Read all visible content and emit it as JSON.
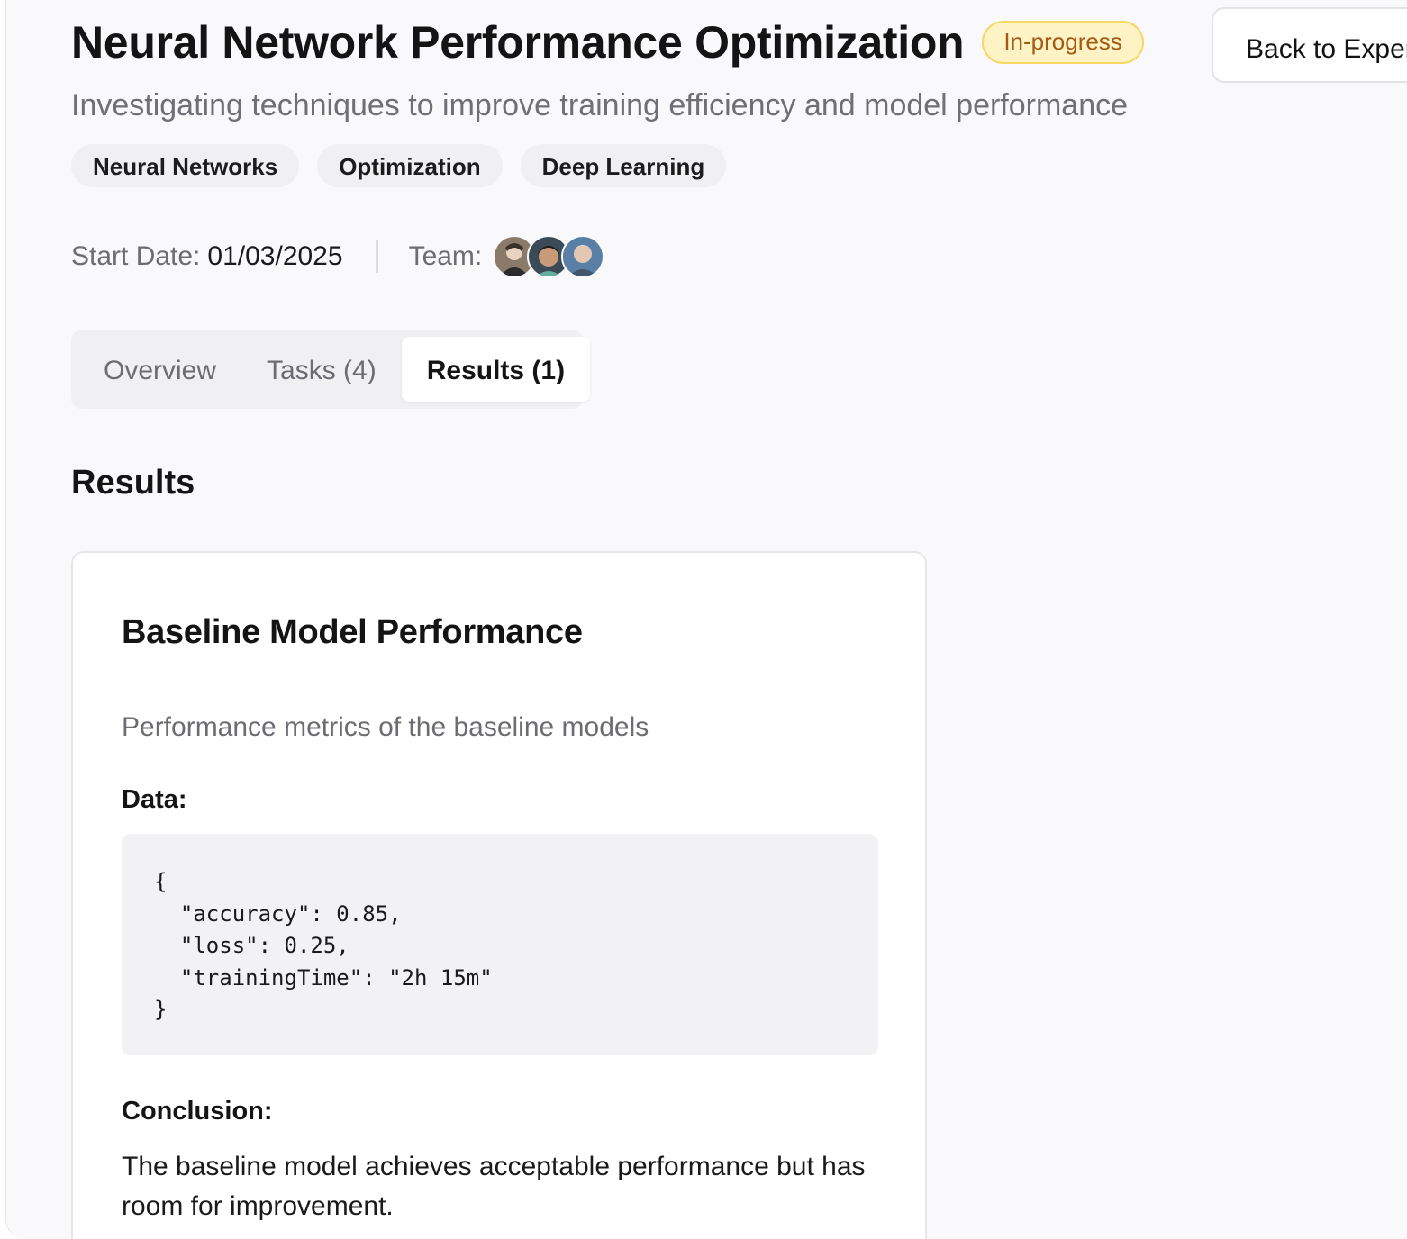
{
  "header": {
    "title": "Neural Network Performance Optimization",
    "status": "In-progress",
    "back_button_label": "Back to Experiments",
    "subtitle": "Investigating techniques to improve training efficiency and model performance"
  },
  "tags": [
    "Neural Networks",
    "Optimization",
    "Deep Learning"
  ],
  "meta": {
    "start_date_label": "Start Date:",
    "start_date": "01/03/2025",
    "team_label": "Team:",
    "team_count": 3
  },
  "tabs": [
    {
      "label": "Overview",
      "active": false
    },
    {
      "label": "Tasks (4)",
      "active": false
    },
    {
      "label": "Results (1)",
      "active": true
    }
  ],
  "results": {
    "heading": "Results",
    "items": [
      {
        "title": "Baseline Model Performance",
        "description": "Performance metrics of the baseline models",
        "data_label": "Data:",
        "data_code": "{\n  \"accuracy\": 0.85,\n  \"loss\": 0.25,\n  \"trainingTime\": \"2h 15m\"\n}",
        "conclusion_label": "Conclusion:",
        "conclusion": "The baseline model achieves acceptable performance but has room for improvement."
      }
    ]
  },
  "colors": {
    "status_bg": "#fdf3c4",
    "status_border": "#f6d865",
    "status_text": "#a45a12",
    "page_bg": "#f9f9fb",
    "muted_text": "#6c6c73"
  }
}
